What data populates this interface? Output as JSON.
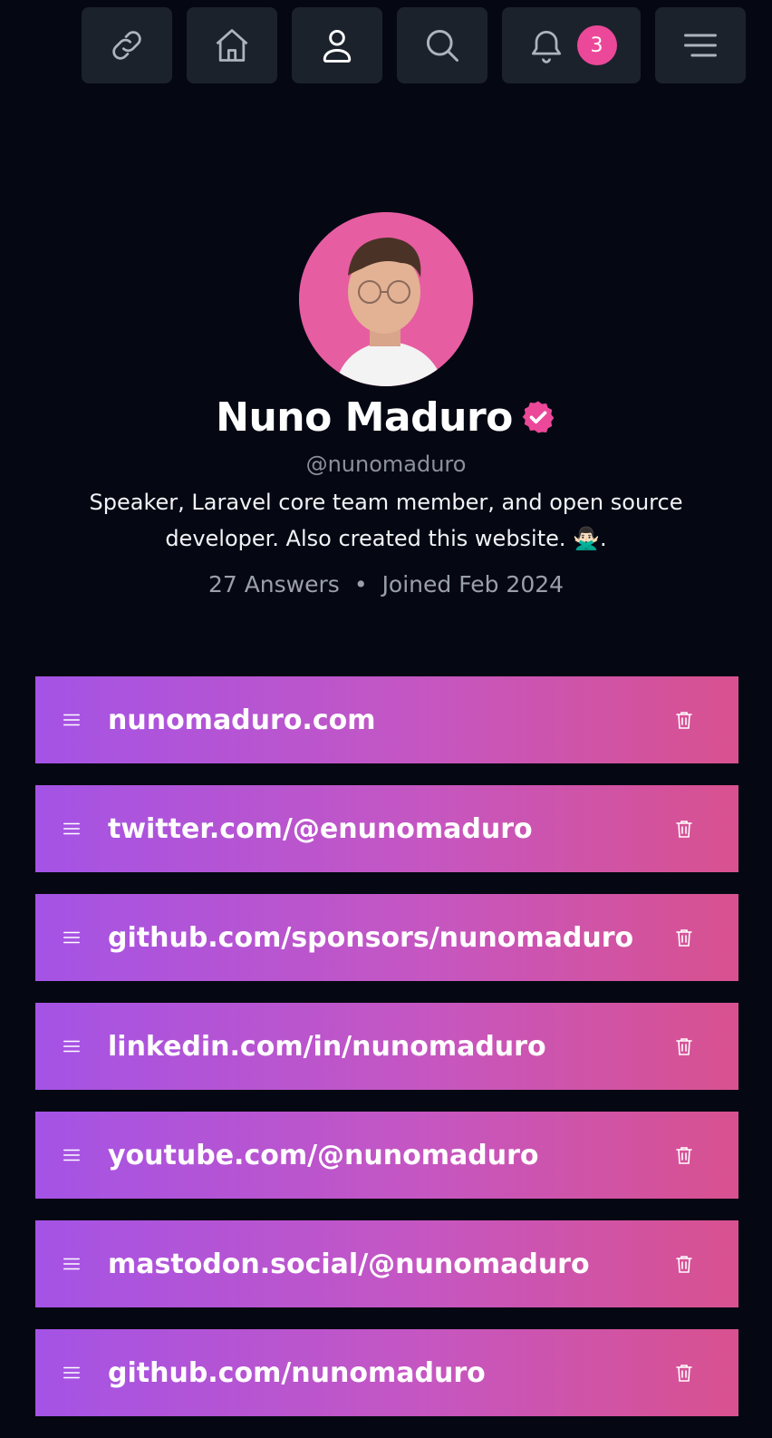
{
  "nav": {
    "items": [
      {
        "name": "link",
        "icon": "link-icon"
      },
      {
        "name": "home",
        "icon": "home-icon"
      },
      {
        "name": "profile",
        "icon": "user-icon"
      },
      {
        "name": "search",
        "icon": "search-icon"
      },
      {
        "name": "notifications",
        "icon": "bell-icon",
        "badge": "3"
      },
      {
        "name": "menu",
        "icon": "menu-icon"
      }
    ]
  },
  "profile": {
    "name": "Nuno Maduro",
    "verified_icon": "verified-badge-icon",
    "username": "@nunomaduro",
    "bio": "Speaker, Laravel core team member, and open source developer. Also created this website. 🙅🏻‍♂️.",
    "stats": {
      "answers": "27 Answers",
      "separator": "•",
      "joined": "Joined Feb 2024"
    }
  },
  "links": [
    {
      "label": "nunomaduro.com"
    },
    {
      "label": "twitter.com/@enunomaduro"
    },
    {
      "label": "github.com/sponsors/nunomaduro"
    },
    {
      "label": "linkedin.com/in/nunomaduro"
    },
    {
      "label": "youtube.com/@nunomaduro"
    },
    {
      "label": "mastodon.social/@nunomaduro"
    },
    {
      "label": "github.com/nunomaduro"
    }
  ],
  "colors": {
    "background": "#050813",
    "nav_button": "#1c222c",
    "accent_pink": "#ec4899",
    "gradient_start": "#a453e6",
    "gradient_end": "#d9518f"
  }
}
